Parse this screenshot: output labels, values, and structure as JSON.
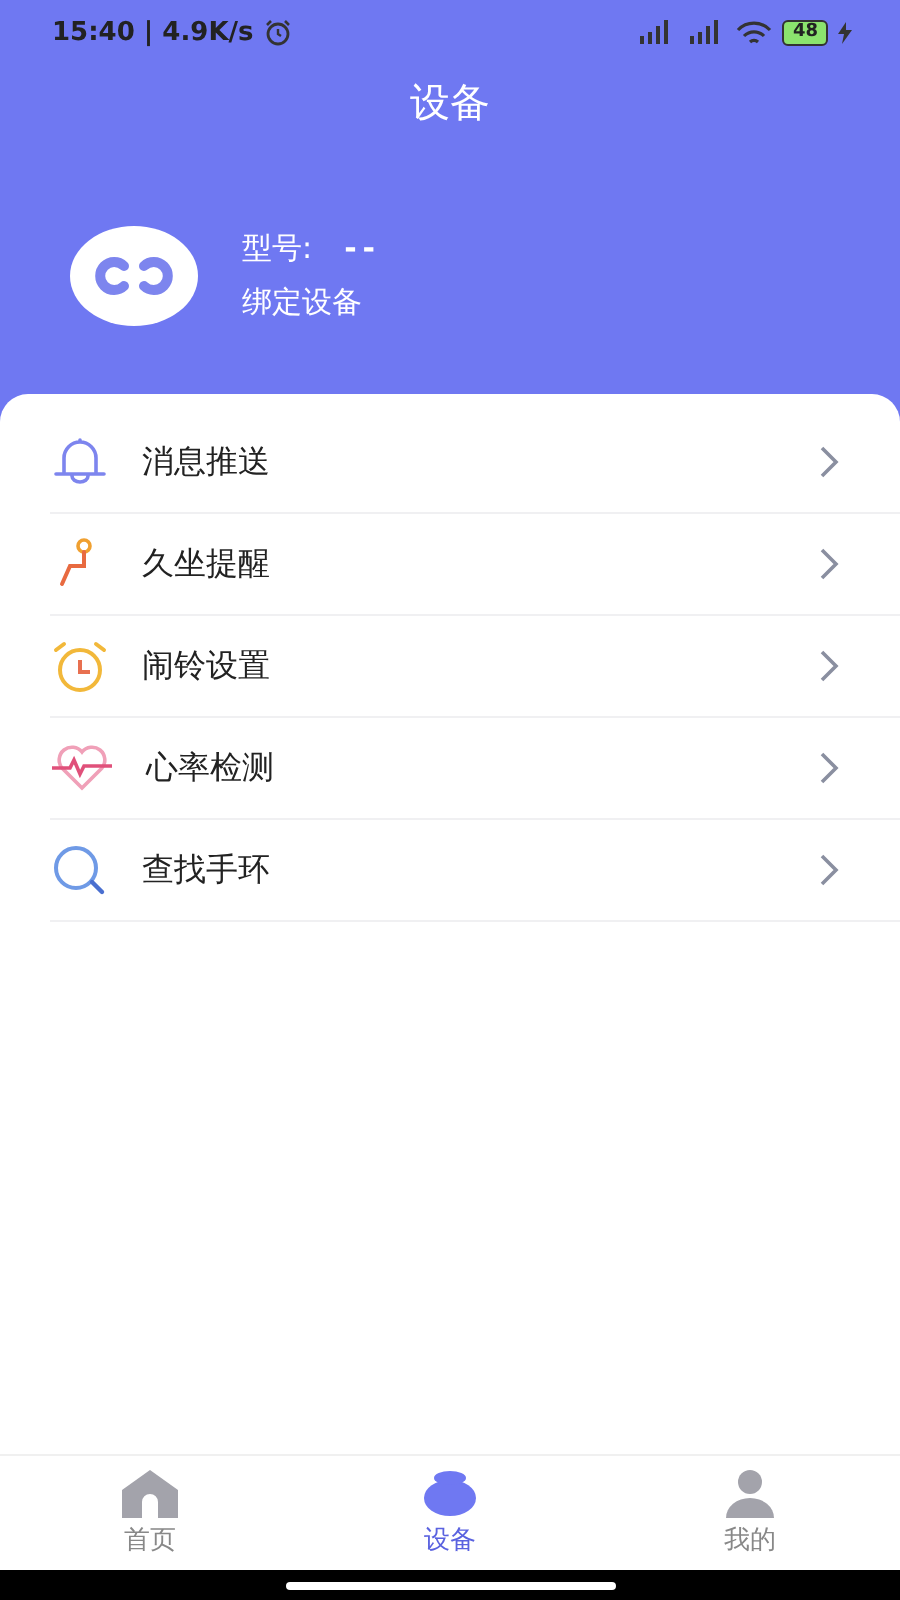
{
  "status_bar": {
    "time": "15:40",
    "separator": "|",
    "speed": "4.9K/s",
    "battery": "48"
  },
  "header": {
    "title": "设备"
  },
  "device": {
    "model_label": "型号:",
    "model_value": "--",
    "bind_label": "绑定设备"
  },
  "menu": [
    {
      "kind": "bell",
      "label": "消息推送"
    },
    {
      "kind": "sit",
      "label": "久坐提醒"
    },
    {
      "kind": "alarm",
      "label": "闹铃设置"
    },
    {
      "kind": "heart",
      "label": "心率检测"
    },
    {
      "kind": "search",
      "label": "查找手环"
    }
  ],
  "tabs": [
    {
      "kind": "home",
      "label": "首页",
      "selected": false
    },
    {
      "kind": "device",
      "label": "设备",
      "selected": true
    },
    {
      "kind": "me",
      "label": "我的",
      "selected": false
    }
  ]
}
